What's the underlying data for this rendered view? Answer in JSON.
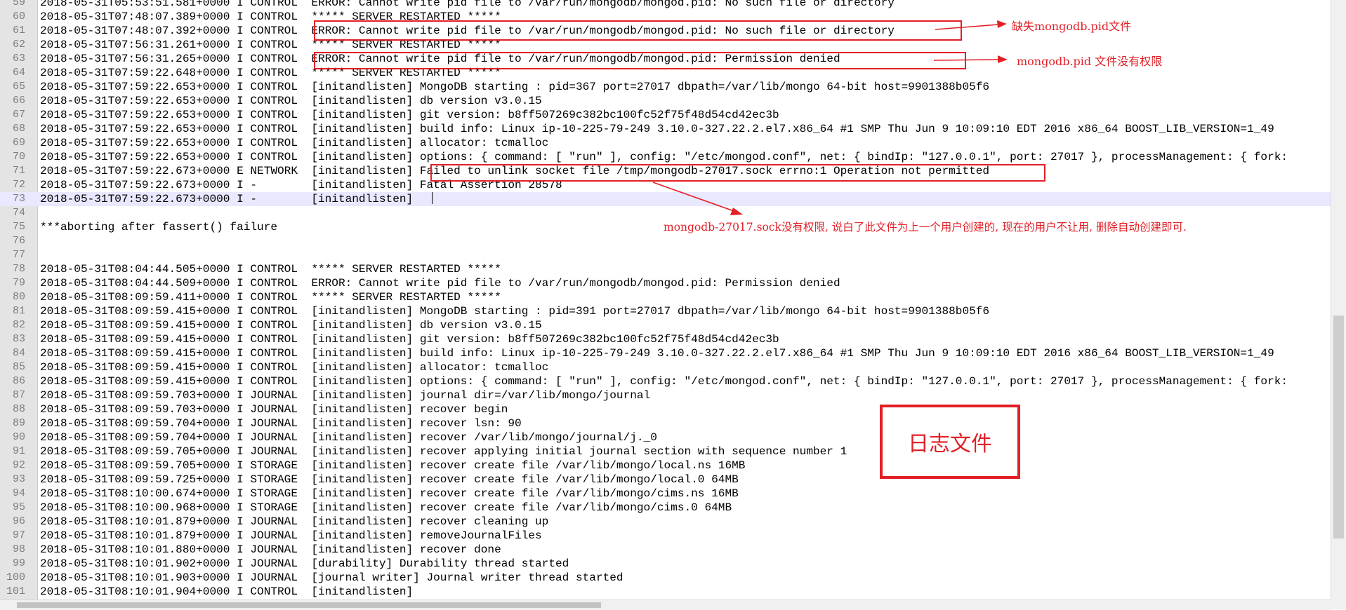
{
  "lines": [
    {
      "n": "59",
      "text": "2018-05-31T05:53:51.581+0000 I CONTROL  ERROR: Cannot write pid file to /var/run/mongodb/mongod.pid: No such file or directory"
    },
    {
      "n": "60",
      "text": "2018-05-31T07:48:07.389+0000 I CONTROL  ***** SERVER RESTARTED *****"
    },
    {
      "n": "61",
      "text": "2018-05-31T07:48:07.392+0000 I CONTROL  ERROR: Cannot write pid file to /var/run/mongodb/mongod.pid: No such file or directory"
    },
    {
      "n": "62",
      "text": "2018-05-31T07:56:31.261+0000 I CONTROL  ***** SERVER RESTARTED *****"
    },
    {
      "n": "63",
      "text": "2018-05-31T07:56:31.265+0000 I CONTROL  ERROR: Cannot write pid file to /var/run/mongodb/mongod.pid: Permission denied"
    },
    {
      "n": "64",
      "text": "2018-05-31T07:59:22.648+0000 I CONTROL  ***** SERVER RESTARTED *****"
    },
    {
      "n": "65",
      "text": "2018-05-31T07:59:22.653+0000 I CONTROL  [initandlisten] MongoDB starting : pid=367 port=27017 dbpath=/var/lib/mongo 64-bit host=9901388b05f6"
    },
    {
      "n": "66",
      "text": "2018-05-31T07:59:22.653+0000 I CONTROL  [initandlisten] db version v3.0.15"
    },
    {
      "n": "67",
      "text": "2018-05-31T07:59:22.653+0000 I CONTROL  [initandlisten] git version: b8ff507269c382bc100fc52f75f48d54cd42ec3b"
    },
    {
      "n": "68",
      "text": "2018-05-31T07:59:22.653+0000 I CONTROL  [initandlisten] build info: Linux ip-10-225-79-249 3.10.0-327.22.2.el7.x86_64 #1 SMP Thu Jun 9 10:09:10 EDT 2016 x86_64 BOOST_LIB_VERSION=1_49"
    },
    {
      "n": "69",
      "text": "2018-05-31T07:59:22.653+0000 I CONTROL  [initandlisten] allocator: tcmalloc"
    },
    {
      "n": "70",
      "text": "2018-05-31T07:59:22.653+0000 I CONTROL  [initandlisten] options: { command: [ \"run\" ], config: \"/etc/mongod.conf\", net: { bindIp: \"127.0.0.1\", port: 27017 }, processManagement: { fork:"
    },
    {
      "n": "71",
      "text": "2018-05-31T07:59:22.673+0000 E NETWORK  [initandlisten] Failed to unlink socket file /tmp/mongodb-27017.sock errno:1 Operation not permitted"
    },
    {
      "n": "72",
      "text": "2018-05-31T07:59:22.673+0000 I -        [initandlisten] Fatal Assertion 28578"
    },
    {
      "n": "73",
      "text": "2018-05-31T07:59:22.673+0000 I -        [initandlisten] "
    },
    {
      "n": "74",
      "text": ""
    },
    {
      "n": "75",
      "text": "***aborting after fassert() failure"
    },
    {
      "n": "76",
      "text": ""
    },
    {
      "n": "77",
      "text": ""
    },
    {
      "n": "78",
      "text": "2018-05-31T08:04:44.505+0000 I CONTROL  ***** SERVER RESTARTED *****"
    },
    {
      "n": "79",
      "text": "2018-05-31T08:04:44.509+0000 I CONTROL  ERROR: Cannot write pid file to /var/run/mongodb/mongod.pid: Permission denied"
    },
    {
      "n": "80",
      "text": "2018-05-31T08:09:59.411+0000 I CONTROL  ***** SERVER RESTARTED *****"
    },
    {
      "n": "81",
      "text": "2018-05-31T08:09:59.415+0000 I CONTROL  [initandlisten] MongoDB starting : pid=391 port=27017 dbpath=/var/lib/mongo 64-bit host=9901388b05f6"
    },
    {
      "n": "82",
      "text": "2018-05-31T08:09:59.415+0000 I CONTROL  [initandlisten] db version v3.0.15"
    },
    {
      "n": "83",
      "text": "2018-05-31T08:09:59.415+0000 I CONTROL  [initandlisten] git version: b8ff507269c382bc100fc52f75f48d54cd42ec3b"
    },
    {
      "n": "84",
      "text": "2018-05-31T08:09:59.415+0000 I CONTROL  [initandlisten] build info: Linux ip-10-225-79-249 3.10.0-327.22.2.el7.x86_64 #1 SMP Thu Jun 9 10:09:10 EDT 2016 x86_64 BOOST_LIB_VERSION=1_49"
    },
    {
      "n": "85",
      "text": "2018-05-31T08:09:59.415+0000 I CONTROL  [initandlisten] allocator: tcmalloc"
    },
    {
      "n": "86",
      "text": "2018-05-31T08:09:59.415+0000 I CONTROL  [initandlisten] options: { command: [ \"run\" ], config: \"/etc/mongod.conf\", net: { bindIp: \"127.0.0.1\", port: 27017 }, processManagement: { fork:"
    },
    {
      "n": "87",
      "text": "2018-05-31T08:09:59.703+0000 I JOURNAL  [initandlisten] journal dir=/var/lib/mongo/journal"
    },
    {
      "n": "88",
      "text": "2018-05-31T08:09:59.703+0000 I JOURNAL  [initandlisten] recover begin"
    },
    {
      "n": "89",
      "text": "2018-05-31T08:09:59.704+0000 I JOURNAL  [initandlisten] recover lsn: 90"
    },
    {
      "n": "90",
      "text": "2018-05-31T08:09:59.704+0000 I JOURNAL  [initandlisten] recover /var/lib/mongo/journal/j._0"
    },
    {
      "n": "91",
      "text": "2018-05-31T08:09:59.705+0000 I JOURNAL  [initandlisten] recover applying initial journal section with sequence number 1"
    },
    {
      "n": "92",
      "text": "2018-05-31T08:09:59.705+0000 I STORAGE  [initandlisten] recover create file /var/lib/mongo/local.ns 16MB"
    },
    {
      "n": "93",
      "text": "2018-05-31T08:09:59.725+0000 I STORAGE  [initandlisten] recover create file /var/lib/mongo/local.0 64MB"
    },
    {
      "n": "94",
      "text": "2018-05-31T08:10:00.674+0000 I STORAGE  [initandlisten] recover create file /var/lib/mongo/cims.ns 16MB"
    },
    {
      "n": "95",
      "text": "2018-05-31T08:10:00.968+0000 I STORAGE  [initandlisten] recover create file /var/lib/mongo/cims.0 64MB"
    },
    {
      "n": "96",
      "text": "2018-05-31T08:10:01.879+0000 I JOURNAL  [initandlisten] recover cleaning up"
    },
    {
      "n": "97",
      "text": "2018-05-31T08:10:01.879+0000 I JOURNAL  [initandlisten] removeJournalFiles"
    },
    {
      "n": "98",
      "text": "2018-05-31T08:10:01.880+0000 I JOURNAL  [initandlisten] recover done"
    },
    {
      "n": "99",
      "text": "2018-05-31T08:10:01.902+0000 I JOURNAL  [durability] Durability thread started"
    },
    {
      "n": "100",
      "text": "2018-05-31T08:10:01.903+0000 I JOURNAL  [journal writer] Journal writer thread started"
    },
    {
      "n": "101",
      "text": "2018-05-31T08:10:01.904+0000 I CONTROL  [initandlisten]"
    }
  ],
  "current_line": "73",
  "annotations": {
    "note_missing_pid": "缺失mongodb.pid文件",
    "note_pid_permission": "mongodb.pid 文件没有权限",
    "note_sock_permission": "mongodb-27017.sock没有权限, 说白了此文件为上一个用户创建的, 现在的用户不让用, 删除自动创建即可.",
    "log_file_label": "日志文件"
  },
  "colors": {
    "annotation": "#e31f26",
    "gutter": "#e4e4e4",
    "current_line": "#e8e8ff",
    "text": "#000000"
  }
}
